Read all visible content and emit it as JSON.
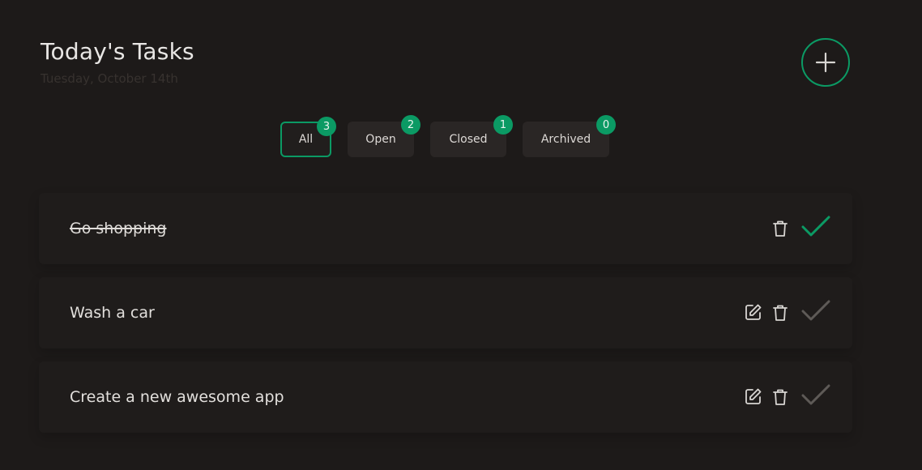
{
  "header": {
    "title": "Today's Tasks",
    "date": "Tuesday, October 14th"
  },
  "filters": [
    {
      "label": "All",
      "count": "3",
      "active": true
    },
    {
      "label": "Open",
      "count": "2",
      "active": false
    },
    {
      "label": "Closed",
      "count": "1",
      "active": false
    },
    {
      "label": "Archived",
      "count": "0",
      "active": false
    }
  ],
  "tasks": [
    {
      "label": "Go shopping",
      "done": true
    },
    {
      "label": "Wash a car",
      "done": false
    },
    {
      "label": "Create a new awesome app",
      "done": false
    }
  ],
  "colors": {
    "accent": "#0b9a64",
    "background": "#1d1a19",
    "muted_check": "#5e5a57"
  },
  "icons": {
    "add": "plus-icon",
    "edit": "edit-icon",
    "delete": "trash-icon",
    "complete": "check-icon"
  }
}
